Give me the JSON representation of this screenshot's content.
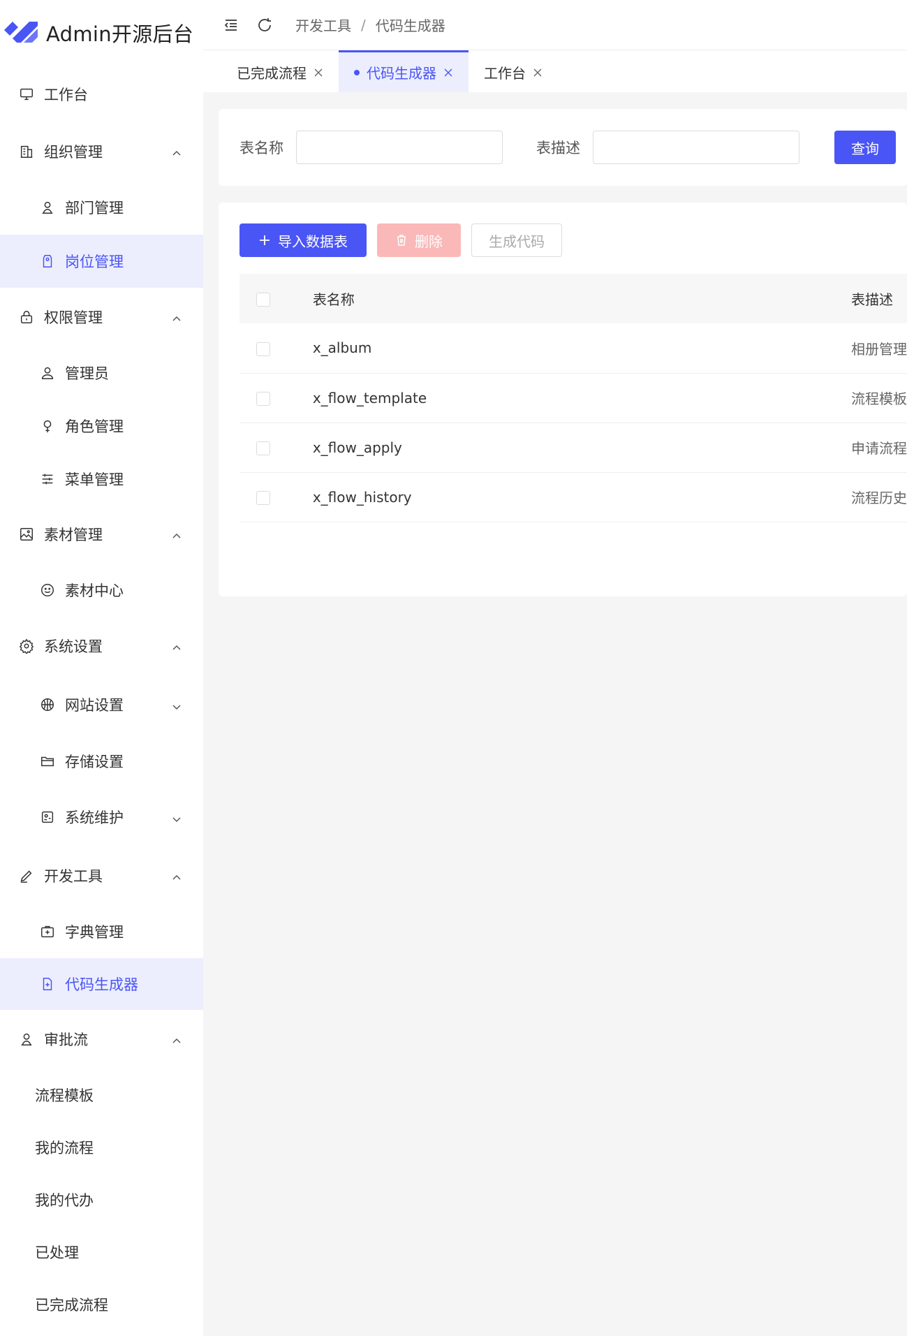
{
  "app": {
    "title": "Admin开源后台"
  },
  "colors": {
    "accent": "#4a55f5",
    "active_bg": "#eceefe",
    "danger_disabled": "#fbb8b8"
  },
  "sidebar": {
    "items": [
      {
        "label": "工作台",
        "icon": "monitor-icon",
        "level": 1
      },
      {
        "label": "组织管理",
        "icon": "building-icon",
        "level": 1,
        "expanded": true
      },
      {
        "label": "部门管理",
        "icon": "user-icon",
        "level": 2
      },
      {
        "label": "岗位管理",
        "icon": "tag-icon",
        "level": 2,
        "active": true
      },
      {
        "label": "权限管理",
        "icon": "lock-icon",
        "level": 1,
        "expanded": true
      },
      {
        "label": "管理员",
        "icon": "user-icon",
        "level": 2
      },
      {
        "label": "角色管理",
        "icon": "female-icon",
        "level": 2
      },
      {
        "label": "菜单管理",
        "icon": "sliders-icon",
        "level": 2
      },
      {
        "label": "素材管理",
        "icon": "image-icon",
        "level": 1,
        "expanded": true
      },
      {
        "label": "素材中心",
        "icon": "smile-icon",
        "level": 2
      },
      {
        "label": "系统设置",
        "icon": "gear-icon",
        "level": 1,
        "expanded": true
      },
      {
        "label": "网站设置",
        "icon": "basketball-icon",
        "level": 2,
        "expanded": false
      },
      {
        "label": "存储设置",
        "icon": "folder-icon",
        "level": 2
      },
      {
        "label": "系统维护",
        "icon": "tools-box-icon",
        "level": 2,
        "expanded": false
      },
      {
        "label": "开发工具",
        "icon": "pen-icon",
        "level": 1,
        "expanded": true
      },
      {
        "label": "字典管理",
        "icon": "briefcase-icon",
        "level": 2
      },
      {
        "label": "代码生成器",
        "icon": "file-add-icon",
        "level": 2,
        "active": true
      },
      {
        "label": "审批流",
        "icon": "stamp-icon",
        "level": 1,
        "expanded": true
      },
      {
        "label": "流程模板",
        "level": 2
      },
      {
        "label": "我的流程",
        "level": 2
      },
      {
        "label": "我的代办",
        "level": 2
      },
      {
        "label": "已处理",
        "level": 2
      },
      {
        "label": "已完成流程",
        "level": 2
      }
    ]
  },
  "header": {
    "breadcrumb": [
      "开发工具",
      "代码生成器"
    ],
    "separator": "/"
  },
  "tabs": [
    {
      "label": "已完成流程",
      "active": false
    },
    {
      "label": "代码生成器",
      "active": true
    },
    {
      "label": "工作台",
      "active": false
    }
  ],
  "search": {
    "table_name_label": "表名称",
    "table_name_value": "",
    "table_desc_label": "表描述",
    "table_desc_value": "",
    "query_button": "查询"
  },
  "toolbar": {
    "import_label": "导入数据表",
    "delete_label": "删除",
    "generate_label": "生成代码"
  },
  "table": {
    "columns": [
      "表名称",
      "表描述"
    ],
    "rows": [
      {
        "name": "x_album",
        "desc": "相册管理"
      },
      {
        "name": "x_flow_template",
        "desc": "流程模板"
      },
      {
        "name": "x_flow_apply",
        "desc": "申请流程"
      },
      {
        "name": "x_flow_history",
        "desc": "流程历史"
      }
    ]
  }
}
